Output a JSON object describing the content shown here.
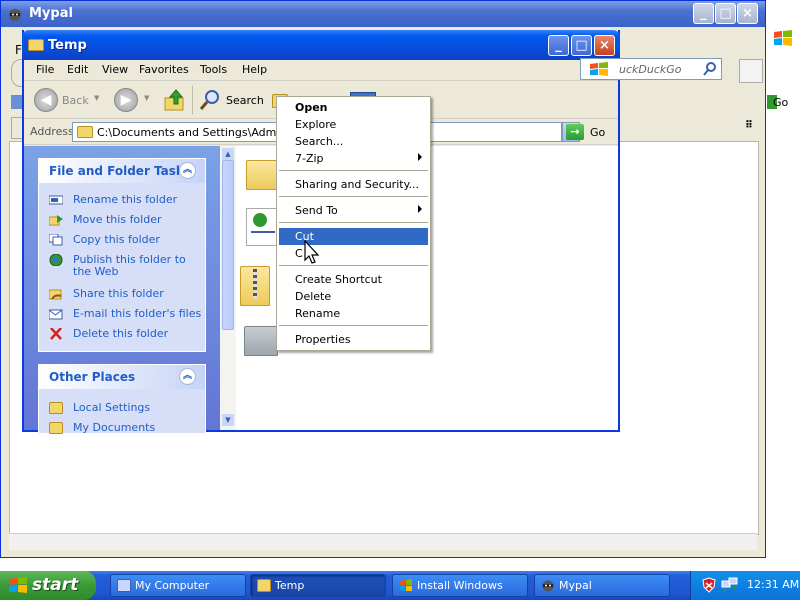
{
  "background_window": {
    "title": "Mypal",
    "partial_letter_left": "F",
    "toolbar_text": "Go"
  },
  "explorer": {
    "title": "Temp",
    "menu": [
      "File",
      "Edit",
      "View",
      "Favorites",
      "Tools",
      "Help"
    ],
    "search_engine_text": "uckDuckGo",
    "toolbar": {
      "back_label": "Back",
      "search_label": "Search"
    },
    "address": {
      "label": "Address",
      "value": "C:\\Documents and Settings\\Administ",
      "go_label": "Go"
    },
    "tasks": {
      "title": "File and Folder Tasks",
      "items": [
        {
          "label": "Rename this folder",
          "icon": "rename-icon"
        },
        {
          "label": "Move this folder",
          "icon": "move-icon"
        },
        {
          "label": "Copy this folder",
          "icon": "copy-icon"
        },
        {
          "label": "Publish this folder to",
          "label2": "the Web",
          "icon": "publish-globe-icon"
        },
        {
          "label": "Share this folder",
          "icon": "share-icon"
        },
        {
          "label": "E-mail this folder's files",
          "icon": "email-icon"
        },
        {
          "label": "Delete this folder",
          "icon": "delete-x-icon"
        }
      ]
    },
    "other_places": {
      "title": "Other Places",
      "items": [
        {
          "label": "Local Settings",
          "icon": "folder-icon"
        },
        {
          "label": "My Documents",
          "icon": "folder-icon"
        }
      ]
    }
  },
  "context_menu": {
    "items": [
      {
        "label": "Open",
        "bold": true
      },
      {
        "label": "Explore"
      },
      {
        "label": "Search..."
      },
      {
        "label": "7-Zip",
        "submenu": true
      },
      {
        "label": "Sharing and Security..."
      },
      {
        "label": "Send To",
        "submenu": true
      },
      {
        "label": "Cut",
        "selected": true
      },
      {
        "label": "Copy"
      },
      {
        "label": "Create Shortcut"
      },
      {
        "label": "Delete"
      },
      {
        "label": "Rename"
      },
      {
        "label": "Properties"
      }
    ],
    "copy_visible_text": "C"
  },
  "taskbar": {
    "start_label": "start",
    "buttons": [
      {
        "label": "My Computer",
        "active": false
      },
      {
        "label": "Temp",
        "active": true
      },
      {
        "label": "Install Windows",
        "active": false
      },
      {
        "label": "Mypal",
        "active": false
      }
    ],
    "clock": "12:31 AM"
  },
  "colors": {
    "xp_blue": "#0058ee",
    "selection": "#316ac5",
    "task_link": "#215dc6",
    "start_green": "#3a9a38"
  }
}
